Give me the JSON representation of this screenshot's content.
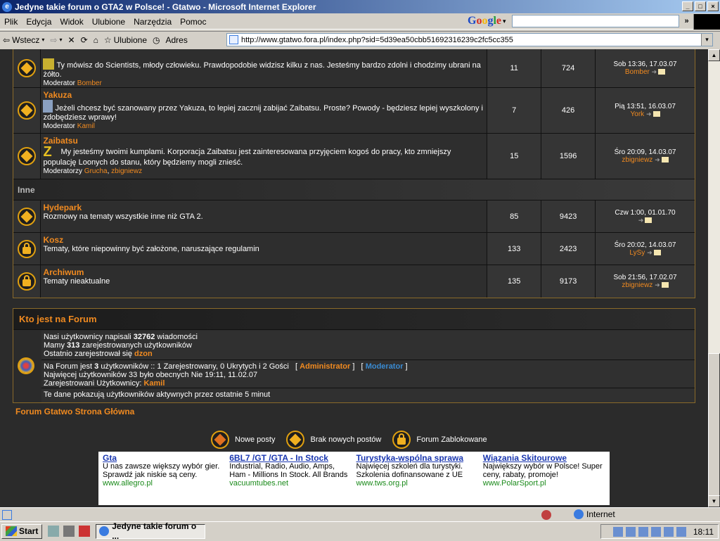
{
  "window": {
    "title": "Jedyne takie forum o GTA2 w Polsce! - Gtatwo - Microsoft Internet Explorer"
  },
  "menu": [
    "Plik",
    "Edycja",
    "Widok",
    "Ulubione",
    "Narzędzia",
    "Pomoc"
  ],
  "toolbar": {
    "back": "Wstecz",
    "favorites": "Ulubione",
    "address_label": "Adres"
  },
  "address": {
    "url": "http://www.gtatwo.fora.pl/index.php?sid=5d39ea50cbb51692316239c2fc5cc355"
  },
  "forums": [
    {
      "name": "",
      "desc": "Ty mówisz do Scientists, młody człowieku. Prawdopodobie widzisz kilku z nas. Jesteśmy bardzo zdolni i chodzimy ubrani na żółto.",
      "mod_label": "Moderator",
      "mods": [
        "Bomber"
      ],
      "topics": "11",
      "posts": "724",
      "last_date": "Sob 13:36, 17.03.07",
      "last_user": "Bomber",
      "icon": "diamond"
    },
    {
      "name": "Yakuza",
      "desc": "Jeżeli chcesz być szanowany przez Yakuza, to lepiej zacznij zabijać Zaibatsu. Proste? Powody - będziesz lepiej wyszkolony i zdobędziesz wprawy!",
      "mod_label": "Moderator",
      "mods": [
        "Kamil"
      ],
      "topics": "7",
      "posts": "426",
      "last_date": "Pią 13:51, 16.03.07",
      "last_user": "York",
      "icon": "diamond"
    },
    {
      "name": "Zaibatsu",
      "desc": "My jesteśmy twoimi kumplami. Korporacja Zaibatsu jest zainteresowana przyjęciem kogoś do pracy, kto zmniejszy populację Loonych do stanu, który będziemy mogli znieść.",
      "mod_label": "Moderatorzy",
      "mods": [
        "Grucha",
        "zbigniewz"
      ],
      "topics": "15",
      "posts": "1596",
      "last_date": "Śro 20:09, 14.03.07",
      "last_user": "zbigniewz",
      "icon": "diamond"
    }
  ],
  "category": "Inne",
  "forums2": [
    {
      "name": "Hydepark",
      "desc": "Rozmowy na tematy wszystkie inne niż GTA 2.",
      "topics": "85",
      "posts": "9423",
      "last_date": "Czw 1:00, 01.01.70",
      "last_user": "",
      "icon": "diamond"
    },
    {
      "name": "Kosz",
      "desc": "Tematy, które niepowinny być założone, naruszające regulamin",
      "topics": "133",
      "posts": "2423",
      "last_date": "Śro 20:02, 14.03.07",
      "last_user": "LySy",
      "icon": "lock"
    },
    {
      "name": "Archiwum",
      "desc": "Tematy nieaktualne",
      "topics": "135",
      "posts": "9173",
      "last_date": "Sob 21:56, 17.02.07",
      "last_user": "zbigniewz",
      "icon": "lock"
    }
  ],
  "who": {
    "title": "Kto jest na Forum",
    "l1a": "Nasi użytkownicy napisali ",
    "posts": "32762",
    "l1b": " wiadomości",
    "l2a": "Mamy ",
    "users": "313",
    "l2b": " zarejestrowanych użytkowników",
    "l3a": "Ostatnio zarejestrował się ",
    "newest": "dzon",
    "l4a": "Na Forum jest ",
    "online": "3",
    "l4b": " użytkowników :: 1 Zarejestrowany, 0 Ukrytych i 2 Gości",
    "admin": "Administrator",
    "moderator": "Moderator",
    "l5": "Najwięcej użytkowników 33 było obecnych Nie 19:11, 11.02.07",
    "l6a": "Zarejestrowani Użytkownicy: ",
    "reg_user": "Kamil",
    "l7": "Te dane pokazują użytkowników aktywnych przez ostatnie 5 minut"
  },
  "home_link": "Forum Gtatwo Strona Główna",
  "legend": {
    "new": "Nowe posty",
    "nonew": "Brak nowych postów",
    "locked": "Forum Zablokowane"
  },
  "ads": [
    {
      "title": "Gta",
      "text": "U nas zawsze większy wybór gier. Sprawdź jak niskie są ceny.",
      "url": "www.allegro.pl"
    },
    {
      "title": "6BL7 /GT /GTA - In Stock",
      "text": "Industrial, Radio, Audio, Amps, Ham - Millions In Stock. All Brands",
      "url": "vacuumtubes.net"
    },
    {
      "title": "Turystyka-wspólna sprawa",
      "text": "Najwięcej szkoleń dla turystyki. Szkolenia dofinansowane z UE",
      "url": "www.tws.org.pl"
    },
    {
      "title": "Wiązania Skitourowe",
      "text": "Największy wybór w Polsce! Super ceny, rabaty, promoje!",
      "url": "www.PolarSport.pl"
    }
  ],
  "status": {
    "zone": "Internet"
  },
  "taskbar": {
    "start": "Start",
    "task": "Jedyne takie forum o ...",
    "clock": "18:11"
  }
}
